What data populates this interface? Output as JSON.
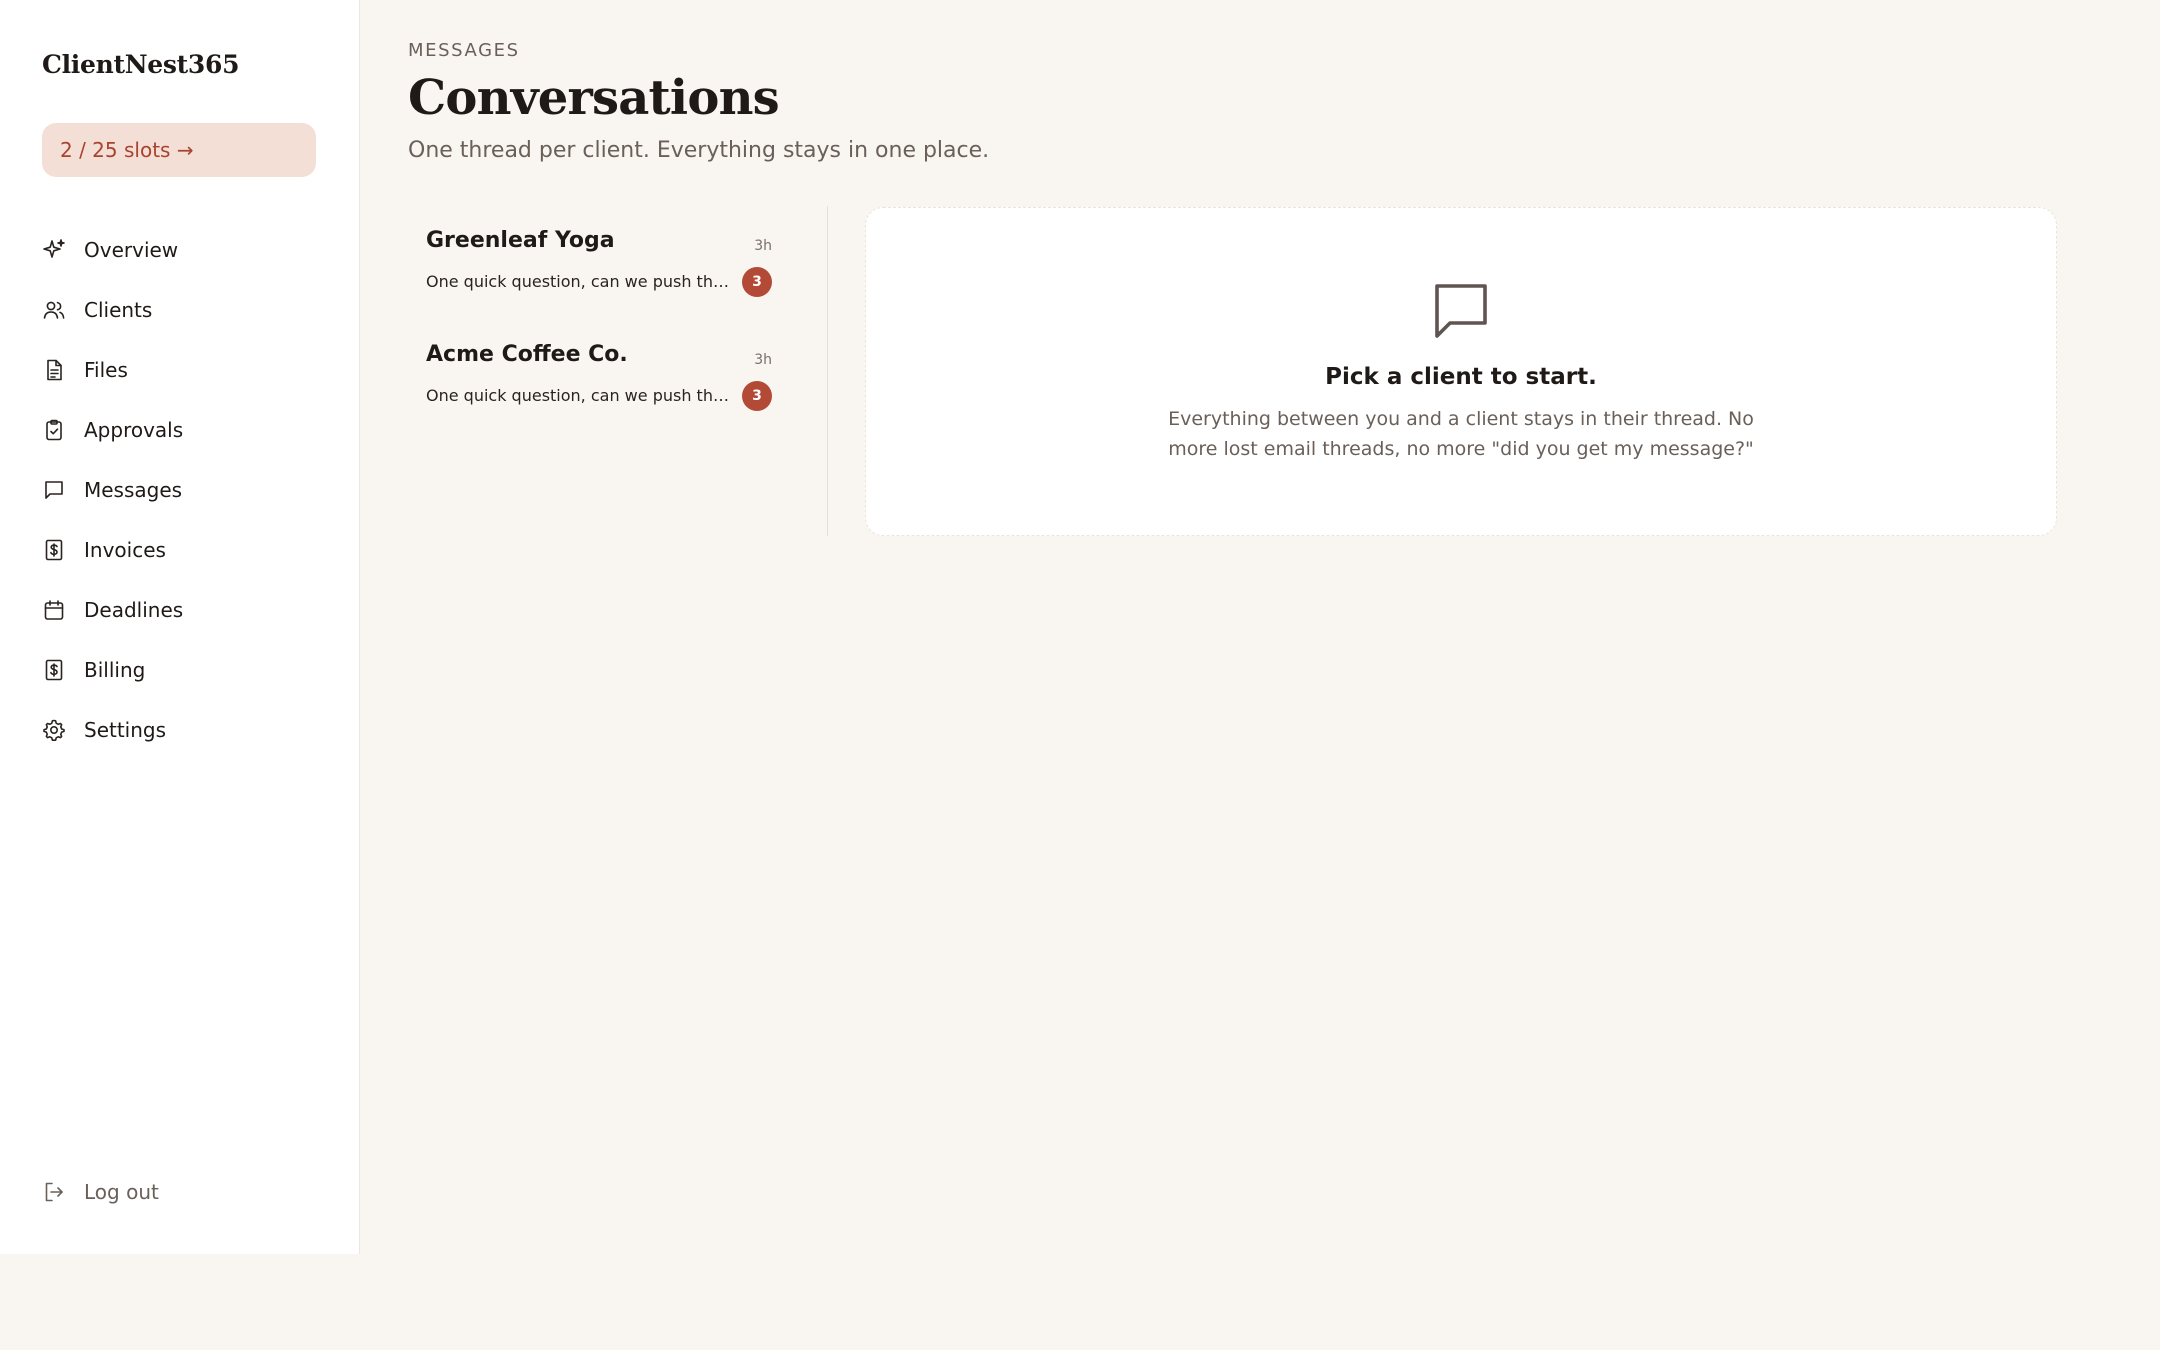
{
  "sidebar": {
    "brand": "ClientNest365",
    "slots_label": "2 / 25 slots →",
    "items": [
      {
        "label": "Overview",
        "icon": "sparkle-icon"
      },
      {
        "label": "Clients",
        "icon": "users-icon"
      },
      {
        "label": "Files",
        "icon": "file-icon"
      },
      {
        "label": "Approvals",
        "icon": "clipboard-check-icon"
      },
      {
        "label": "Messages",
        "icon": "message-icon"
      },
      {
        "label": "Invoices",
        "icon": "dollar-doc-icon"
      },
      {
        "label": "Deadlines",
        "icon": "calendar-icon"
      },
      {
        "label": "Billing",
        "icon": "dollar-doc-icon"
      },
      {
        "label": "Settings",
        "icon": "gear-icon"
      }
    ],
    "logout_label": "Log out"
  },
  "header": {
    "eyebrow": "MESSAGES",
    "title": "Conversations",
    "subtitle": "One thread per client. Everything stays in one place."
  },
  "conversations": [
    {
      "name": "Greenleaf Yoga",
      "time": "3h",
      "preview": "One quick question, can we push the ...",
      "unread": "3"
    },
    {
      "name": "Acme Coffee Co.",
      "time": "3h",
      "preview": "One quick question, can we push the ...",
      "unread": "3"
    }
  ],
  "empty_state": {
    "icon": "message-icon",
    "title": "Pick a client to start.",
    "body": "Everything between you and a client stays in their thread. No more lost email threads, no more \"did you get my message?\""
  },
  "colors": {
    "background": "#f9f6f1",
    "accent": "#b24a36",
    "slots_bg": "#f4dfd6",
    "slots_text": "#a8432f"
  }
}
